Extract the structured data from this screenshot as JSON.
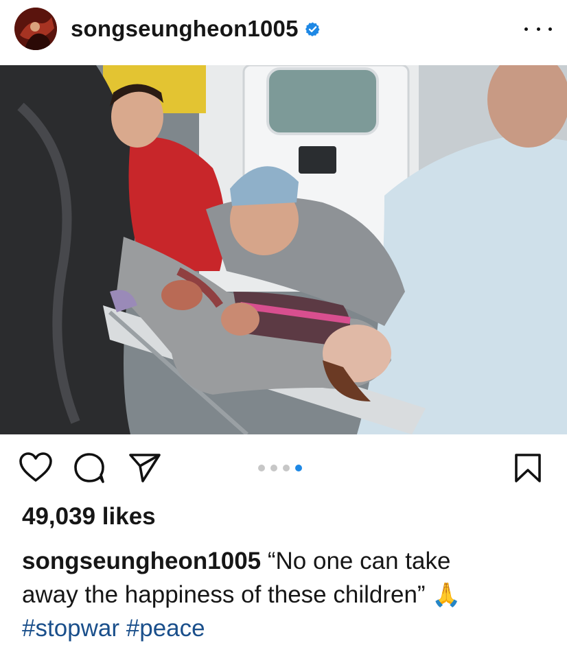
{
  "post": {
    "username": "songseungheon1005",
    "verified": true,
    "more_label": "More options",
    "carousel": {
      "total": 4,
      "active_index": 3
    },
    "likes_text": "49,039 likes",
    "caption": {
      "username": "songseungheon1005",
      "text_line1": "“No one can take",
      "text_line2": "away the happiness of these children”",
      "emoji": "🙏"
    },
    "hashtags": [
      "#stopwar",
      "#peace"
    ]
  },
  "icons": {
    "like": "heart-icon",
    "comment": "comment-icon",
    "share": "paper-plane-icon",
    "save": "bookmark-icon",
    "more": "ellipsis-icon",
    "verified": "verified-badge-icon"
  },
  "colors": {
    "text": "#161616",
    "hashtag": "#1a4f8b",
    "verified": "#1e88e5",
    "carousel_active": "#1e88e5",
    "carousel_inactive": "#c7c7c7"
  }
}
